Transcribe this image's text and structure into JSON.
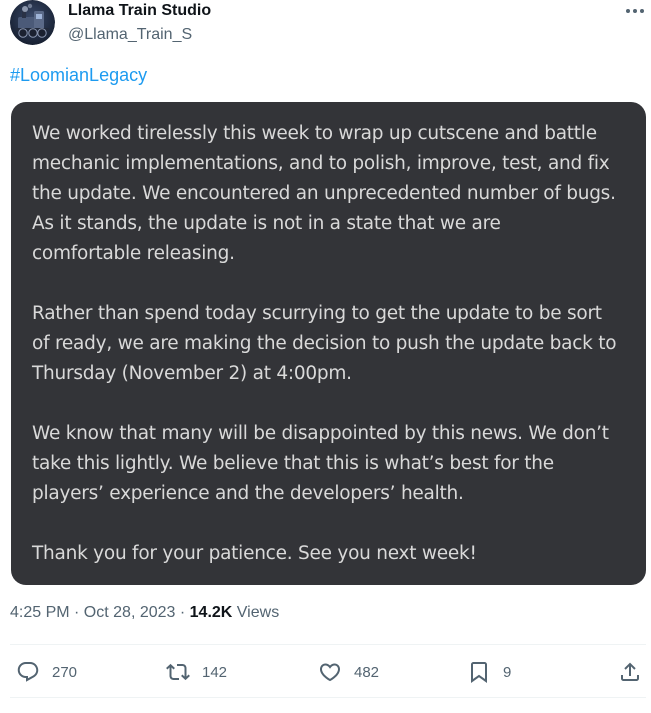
{
  "author": {
    "name": "Llama Train Studio",
    "handle": "@Llama_Train_S"
  },
  "post": {
    "hashtag": "#LoomianLegacy",
    "image_paragraphs": [
      "We worked tirelessly this week to wrap up cutscene and battle\nmechanic implementations, and to polish, improve, test, and fix\nthe update. We encountered an unprecedented number of bugs.\nAs it stands, the update is not in a state that we are\ncomfortable releasing.",
      "Rather than spend today scurrying to get the update to be sort\nof ready, we are making the decision to push the update back to\nThursday (November 2) at 4:00pm.",
      "We know that many will be disappointed by this news. We don’t\ntake this lightly. We believe that this is what’s best for the\nplayers’ experience and the developers’ health.",
      "Thank you for your patience. See you next week!"
    ],
    "timestamp": "4:25 PM · Oct 28, 2023",
    "separator": " · ",
    "views_count": "14.2K",
    "views_label": "Views"
  },
  "actions": {
    "reply": {
      "icon": "reply-icon",
      "count": "270"
    },
    "repost": {
      "icon": "repost-icon",
      "count": "142"
    },
    "like": {
      "icon": "heart-icon",
      "count": "482"
    },
    "bookmark": {
      "icon": "bookmark-icon",
      "count": "9"
    },
    "share": {
      "icon": "share-icon"
    }
  },
  "colors": {
    "link": "#1d9bf0",
    "secondary_text": "#536471",
    "media_background": "#333438"
  }
}
